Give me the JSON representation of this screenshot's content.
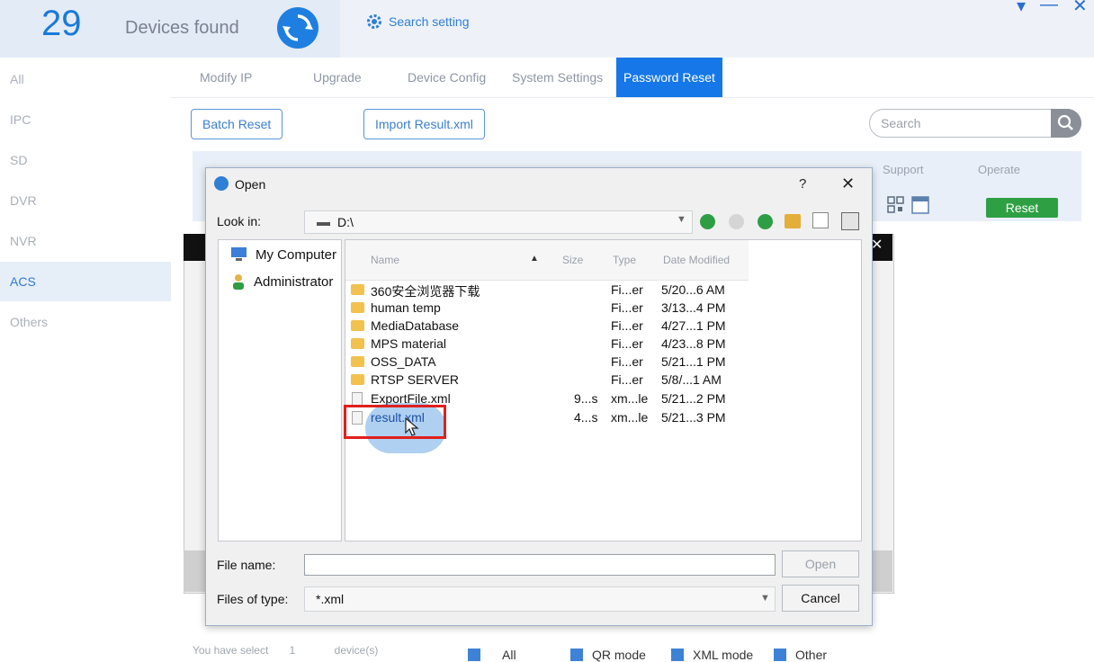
{
  "header": {
    "device_count": "29",
    "devices_found_label": "Devices found",
    "search_setting_label": "Search setting",
    "window_controls": [
      "▾",
      "—",
      "✕"
    ]
  },
  "sidebar": {
    "items": [
      {
        "label": "All"
      },
      {
        "label": "IPC"
      },
      {
        "label": "SD"
      },
      {
        "label": "DVR"
      },
      {
        "label": "NVR"
      },
      {
        "label": "ACS",
        "active": true
      },
      {
        "label": "Others"
      }
    ]
  },
  "tabs": [
    {
      "label": "Modify IP"
    },
    {
      "label": "Upgrade"
    },
    {
      "label": "Device Config"
    },
    {
      "label": "System Settings"
    },
    {
      "label": "Password Reset",
      "active": true
    }
  ],
  "toolbar": {
    "batch_reset_label": "Batch Reset",
    "import_result_label": "Import Result.xml",
    "search_placeholder": "Search"
  },
  "table": {
    "headers": {
      "support": "Support",
      "operate": "Operate"
    },
    "row": {
      "reset_label": "Reset"
    }
  },
  "footer": {
    "you_have_select": "You have select",
    "selected_count": "1",
    "devices_unit": "device(s)",
    "legend": [
      "All",
      "QR mode",
      "XML mode",
      "Other"
    ],
    "legend_color": "#3d82d6"
  },
  "dialog": {
    "title": "Open",
    "help": "?",
    "close": "✕",
    "look_in_label": "Look in:",
    "look_in_value": "D:\\",
    "left_pane": [
      "My Computer",
      "Administrator"
    ],
    "columns": {
      "name": "Name",
      "size": "Size",
      "type": "Type",
      "date": "Date Modified"
    },
    "files": [
      {
        "kind": "folder",
        "name": "360安全浏览器下载",
        "size": "",
        "type": "Fi...er",
        "date": "5/20...6 AM"
      },
      {
        "kind": "folder",
        "name": "human temp",
        "size": "",
        "type": "Fi...er",
        "date": "3/13...4 PM"
      },
      {
        "kind": "folder",
        "name": "MediaDatabase",
        "size": "",
        "type": "Fi...er",
        "date": "4/27...1 PM"
      },
      {
        "kind": "folder",
        "name": "MPS material",
        "size": "",
        "type": "Fi...er",
        "date": "4/23...8 PM"
      },
      {
        "kind": "folder",
        "name": "OSS_DATA",
        "size": "",
        "type": "Fi...er",
        "date": "5/21...1 PM"
      },
      {
        "kind": "folder",
        "name": "RTSP SERVER",
        "size": "",
        "type": "Fi...er",
        "date": "5/8/...1 AM"
      },
      {
        "kind": "file",
        "name": "ExportFile.xml",
        "size": "9...s",
        "type": "xm...le",
        "date": "5/21...2 PM"
      },
      {
        "kind": "file",
        "name": "result.xml",
        "size": "4...s",
        "type": "xm...le",
        "date": "5/21...3 PM",
        "highlighted": true
      }
    ],
    "file_name_label": "File name:",
    "file_name_value": "",
    "files_of_type_label": "Files of type:",
    "files_of_type_value": "*.xml",
    "open_label": "Open",
    "cancel_label": "Cancel",
    "accent_color": "#1677e8",
    "highlight_color": "#e0201d"
  }
}
